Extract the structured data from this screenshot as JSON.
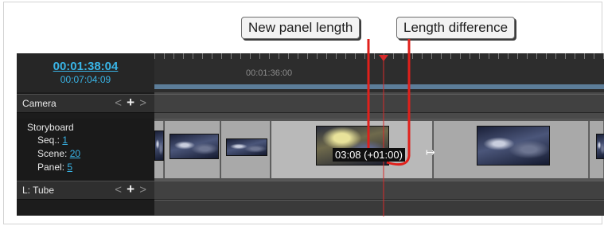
{
  "callouts": {
    "new_panel_length": "New panel length",
    "length_difference": "Length difference"
  },
  "timecode": {
    "current": "00:01:38:04",
    "total": "00:07:04:09"
  },
  "ruler": {
    "marker_time": "00:01:36:00"
  },
  "tracks": {
    "camera": {
      "label": "Camera",
      "add": "+"
    },
    "storyboard": {
      "label": "Storyboard",
      "seq_label": "Seq.:",
      "seq_value": "1",
      "scene_label": "Scene:",
      "scene_value": "20",
      "panel_label": "Panel:",
      "panel_value": "5"
    },
    "tube": {
      "label": "L: Tube",
      "add": "+"
    }
  },
  "drag_tooltip": "03:08 (+01:00)",
  "icons": {
    "playhead": "playhead-marker-icon",
    "resize": "resize-arrow-icon"
  },
  "colors": {
    "accent_blue": "#39b4e6",
    "annotation_red": "#e0201b",
    "playhead_red": "#d62a2a"
  }
}
